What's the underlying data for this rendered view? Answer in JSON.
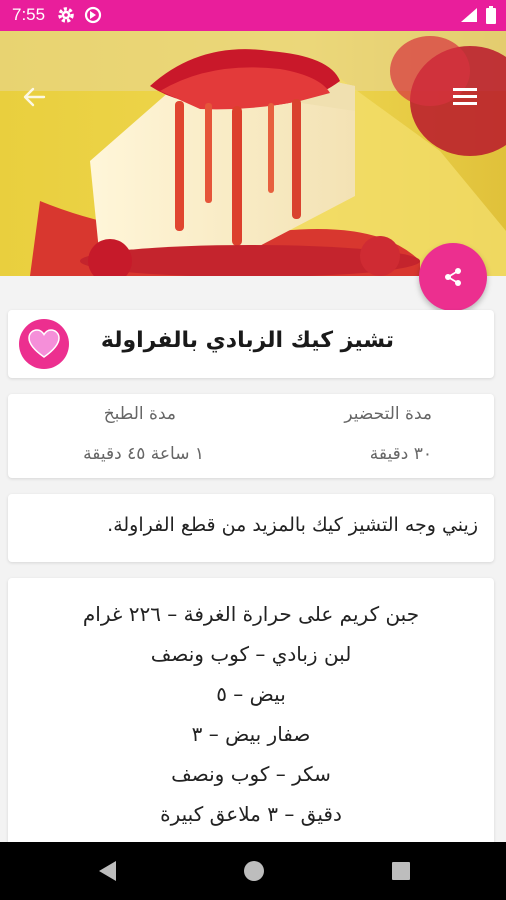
{
  "status": {
    "time": "7:55"
  },
  "recipe": {
    "title": "تشيز كيك الزبادي بالفراولة",
    "description": "زيني وجه التشيز كيك بالمزيد من قطع الفراولة."
  },
  "times": {
    "prep_label": "مدة التحضير",
    "prep_value": "٣٠ دقيقة",
    "cook_label": "مدة الطبخ",
    "cook_value": "١ ساعة ٤٥ دقيقة"
  },
  "ingredients": [
    "جبن كريم على حرارة الغرفة – ٢٢٦ غرام",
    "لبن زبادي – كوب ونصف",
    "بيض – ٥",
    "صفار بيض – ٣",
    "سكر – كوب ونصف",
    "دقيق – ٣ ملاعق كبيرة"
  ],
  "icons": {
    "back": "arrow-back-icon",
    "menu": "hamburger-menu-icon",
    "share": "share-icon",
    "favorite": "heart-icon"
  },
  "colors": {
    "accent": "#e91e9b",
    "fab": "#ec2f8f",
    "favorite_fill": "#f58fd9"
  }
}
